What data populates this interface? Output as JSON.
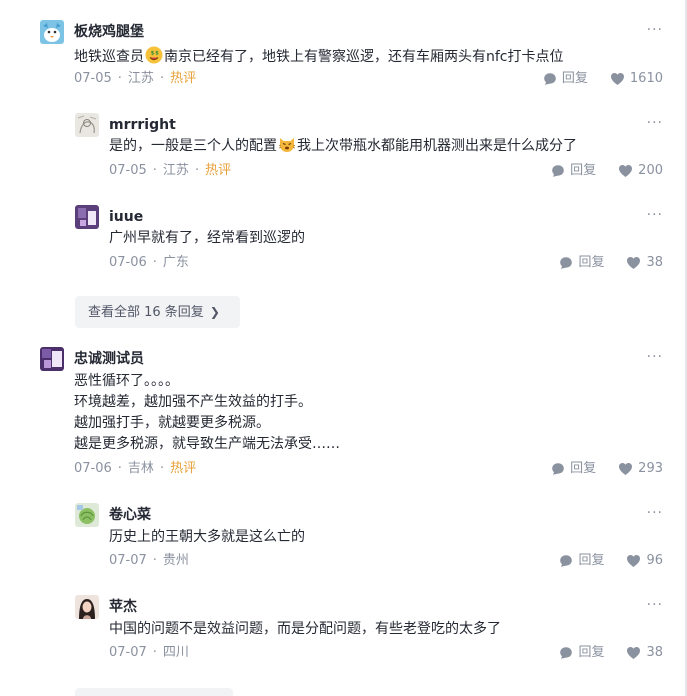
{
  "comments": [
    {
      "username": "板烧鸡腿堡",
      "text_before": "地铁巡查员",
      "emoji": "cash-face-emoji",
      "text_after": "南京已经有了，地铁上有警察巡逻，还有车厢两头有nfc打卡点位",
      "date": "07-05",
      "location": "江苏",
      "tag": "热评",
      "reply_label": "回复",
      "likes": "1610",
      "more": "···",
      "replies": [
        {
          "username": "mrrright",
          "text_before": "是的，一般是三个人的配置",
          "emoji": "cat-emoji",
          "text_after": "我上次带瓶水都能用机器测出来是什么成分了",
          "date": "07-05",
          "location": "江苏",
          "tag": "热评",
          "reply_label": "回复",
          "likes": "200",
          "more": "···"
        },
        {
          "username": "iuue",
          "text": "广州早就有了，经常看到巡逻的",
          "date": "07-06",
          "location": "广东",
          "reply_label": "回复",
          "likes": "38",
          "more": "···"
        }
      ],
      "expand_label": "查看全部 16 条回复",
      "expand_chevron": "❯"
    },
    {
      "username": "忠诚测试员",
      "lines": [
        "恶性循环了。。。。",
        "环境越差，越加强不产生效益的打手。",
        "越加强打手，就越要更多税源。",
        "越是更多税源，就导致生产端无法承受……"
      ],
      "date": "07-06",
      "location": "吉林",
      "tag": "热评",
      "reply_label": "回复",
      "likes": "293",
      "more": "···",
      "replies": [
        {
          "username": "卷心菜",
          "text": "历史上的王朝大多就是这么亡的",
          "date": "07-07",
          "location": "贵州",
          "reply_label": "回复",
          "likes": "96",
          "more": "···"
        },
        {
          "username": "苹杰",
          "text": "中国的问题不是效益问题，而是分配问题，有些老登吃的太多了",
          "date": "07-07",
          "location": "四川",
          "reply_label": "回复",
          "likes": "38",
          "more": "···"
        }
      ]
    }
  ],
  "separator": "·",
  "colors": {
    "text": "#252933",
    "muted": "#8a919f",
    "hot": "#e8a13a",
    "chip_bg": "#f2f3f5"
  },
  "icons": {
    "reply": "comment-bubble-icon",
    "like": "heart-icon",
    "more": "more-dots-icon"
  }
}
